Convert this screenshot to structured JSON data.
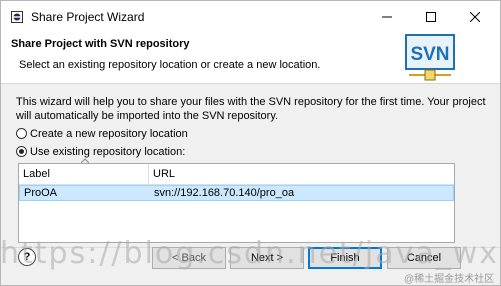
{
  "window": {
    "title": "Share Project Wizard",
    "icons": {
      "app": "eclipse-app-icon",
      "minimize": "minimize-icon",
      "maximize": "maximize-icon",
      "close": "close-icon"
    }
  },
  "banner": {
    "title": "Share Project with SVN repository",
    "description": "Select an existing repository location or create a new location.",
    "logo_text": "SVN",
    "logo_color": "#1f6fb5"
  },
  "intro": "This wizard will help you to share your files with the SVN repository for the first time. Your project will automatically be imported into the SVN repository.",
  "options": [
    {
      "label": "Create a new repository location",
      "selected": false
    },
    {
      "label": "Use existing repository location:",
      "selected": true
    }
  ],
  "table": {
    "columns": [
      "Label",
      "URL"
    ],
    "rows": [
      {
        "label": "ProOA",
        "url": "svn://192.168.70.140/pro_oa",
        "selected": true
      }
    ]
  },
  "buttons": {
    "back": "< Back",
    "next": "Next >",
    "finish": "Finish",
    "cancel": "Cancel",
    "help": "?"
  },
  "watermark": {
    "main": "https://blog.csdn.net/java_wx",
    "corner": "@稀土掘金技术社区"
  },
  "colors": {
    "selection": "#cce8ff",
    "default_button_border": "#0078d7"
  }
}
